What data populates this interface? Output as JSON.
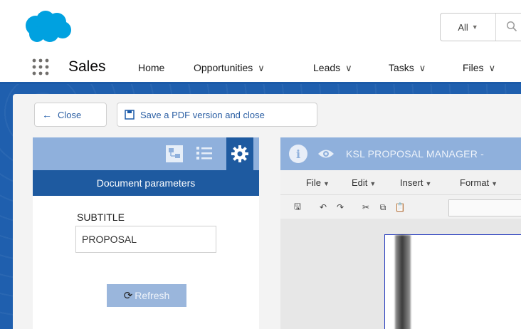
{
  "header": {
    "logo_icon": "salesforce-cloud-logo",
    "search_scope": "All",
    "search_icon": "search-icon"
  },
  "nav": {
    "app_name": "Sales",
    "items": [
      {
        "label": "Home",
        "has_menu": false
      },
      {
        "label": "Opportunities",
        "has_menu": true
      },
      {
        "label": "Leads",
        "has_menu": true
      },
      {
        "label": "Tasks",
        "has_menu": true
      },
      {
        "label": "Files",
        "has_menu": true
      }
    ]
  },
  "actions": {
    "close_label": "Close",
    "save_pdf_label": "Save a PDF version and close"
  },
  "left_panel": {
    "title": "Document parameters",
    "field_label": "SUBTITLE",
    "field_value": "PROPOSAL",
    "refresh_label": "Refresh"
  },
  "right_panel": {
    "title": "KSL PROPOSAL MANAGER -",
    "menus": [
      "File",
      "Edit",
      "Insert",
      "Format"
    ]
  },
  "colors": {
    "brand_blue": "#1e5aa0",
    "light_blue": "#8fb0dc",
    "salesforce_blue": "#00a1e0"
  }
}
